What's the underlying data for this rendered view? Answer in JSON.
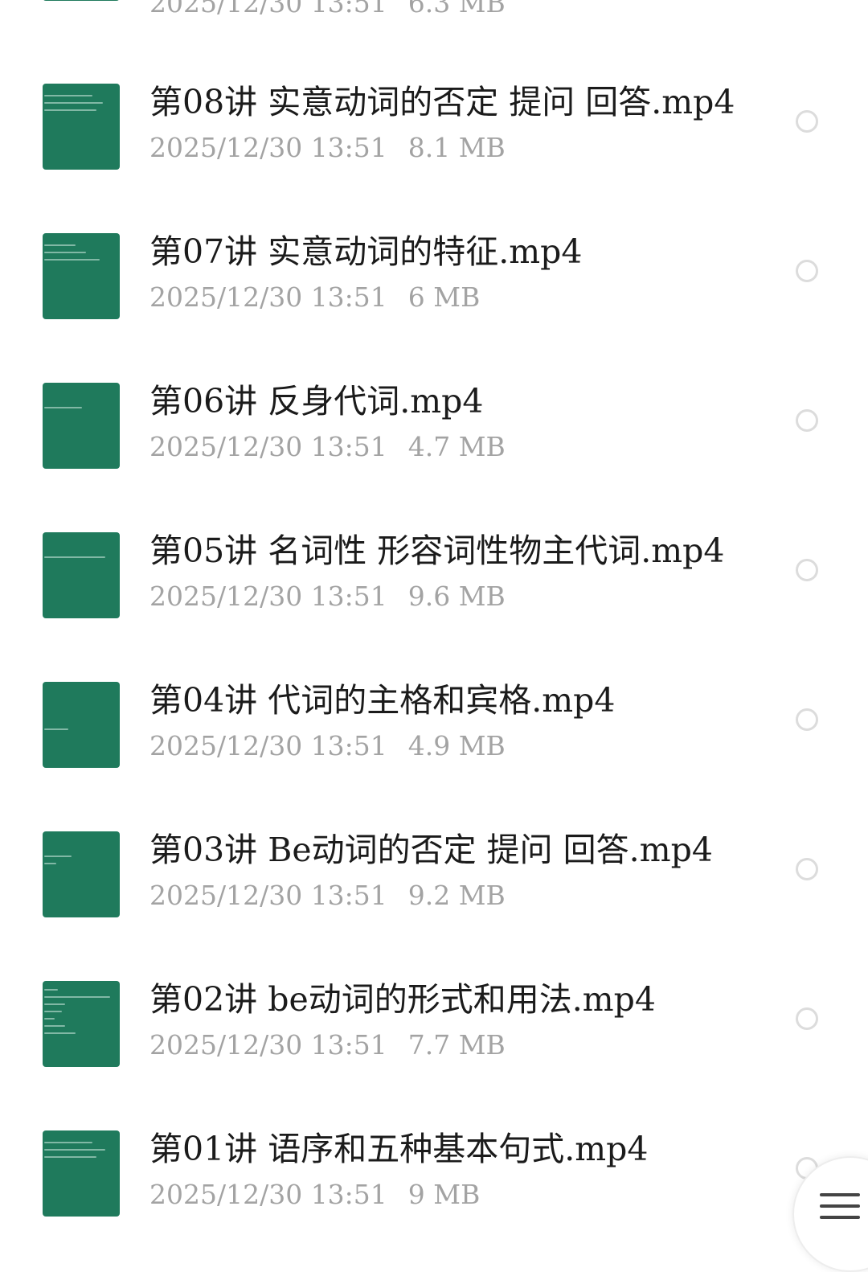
{
  "files": [
    {
      "name": "",
      "date": "2025/12/30 13:51",
      "size": "6.3 MB"
    },
    {
      "name": "第08讲 实意动词的否定 提问 回答.mp4",
      "date": "2025/12/30 13:51",
      "size": "8.1 MB"
    },
    {
      "name": "第07讲 实意动词的特征.mp4",
      "date": "2025/12/30 13:51",
      "size": "6 MB"
    },
    {
      "name": "第06讲 反身代词.mp4",
      "date": "2025/12/30 13:51",
      "size": "4.7 MB"
    },
    {
      "name": "第05讲 名词性 形容词性物主代词.mp4",
      "date": "2025/12/30 13:51",
      "size": "9.6 MB"
    },
    {
      "name": "第04讲 代词的主格和宾格.mp4",
      "date": "2025/12/30 13:51",
      "size": "4.9 MB"
    },
    {
      "name": "第03讲 Be动词的否定 提问 回答.mp4",
      "date": "2025/12/30 13:51",
      "size": "9.2 MB"
    },
    {
      "name": "第02讲 be动词的形式和用法.mp4",
      "date": "2025/12/30 13:51",
      "size": "7.7 MB"
    },
    {
      "name": "第01讲 语序和五种基本句式.mp4",
      "date": "2025/12/30 13:51",
      "size": "9 MB"
    }
  ],
  "colors": {
    "thumbnail": "#1f7a5c",
    "name_text": "#1b1b1b",
    "meta_text": "#a3a3a3",
    "radio_border": "#dcdcdc"
  },
  "icons": {
    "thumbnail": "video-thumbnail",
    "select": "radio-circle-icon",
    "menu": "hamburger-menu-icon"
  }
}
